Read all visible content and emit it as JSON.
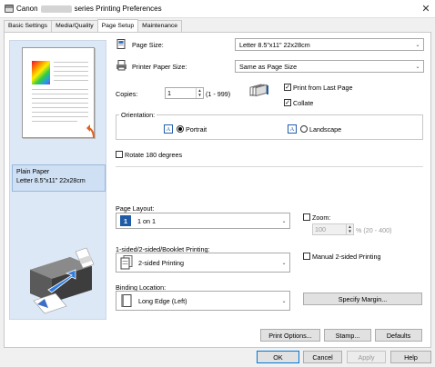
{
  "window": {
    "title_left": "Canon",
    "title_right": "series Printing Preferences",
    "close_label": "✕"
  },
  "tabs": [
    {
      "label": "Basic Settings"
    },
    {
      "label": "Media/Quality"
    },
    {
      "label": "Page Setup"
    },
    {
      "label": "Maintenance"
    }
  ],
  "preview": {
    "media_line1": "Plain Paper",
    "media_line2": "Letter 8.5\"x11\" 22x28cm"
  },
  "page_size": {
    "label": "Page Size:",
    "value": "Letter 8.5\"x11\" 22x28cm"
  },
  "printer_paper_size": {
    "label": "Printer Paper Size:",
    "value": "Same as Page Size"
  },
  "copies": {
    "label": "Copies:",
    "value": "1",
    "range": "(1 - 999)"
  },
  "print_from_last_page": {
    "label": "Print from Last Page",
    "checked": true
  },
  "collate": {
    "label": "Collate",
    "checked": true
  },
  "orientation": {
    "label": "Orientation:",
    "portrait_label": "Portrait",
    "landscape_label": "Landscape",
    "portrait_icon": "A",
    "landscape_icon": "A",
    "selected": "Portrait"
  },
  "rotate_180": {
    "label": "Rotate 180 degrees",
    "checked": false
  },
  "page_layout": {
    "label": "Page Layout:",
    "value": "1 on 1",
    "icon_text": "1"
  },
  "zoom": {
    "label": "Zoom:",
    "checked": false,
    "value": "100",
    "range": "% (20 - 400)"
  },
  "duplex": {
    "label": "1-sided/2-sided/Booklet Printing:",
    "value": "2-sided Printing"
  },
  "manual_duplex": {
    "label": "Manual 2-sided Printing",
    "checked": false
  },
  "binding": {
    "label": "Binding Location:",
    "value": "Long Edge (Left)"
  },
  "buttons": {
    "specify_margin": "Specify Margin...",
    "print_options": "Print Options...",
    "stamp": "Stamp...",
    "defaults": "Defaults",
    "ok": "OK",
    "cancel": "Cancel",
    "apply": "Apply",
    "help": "Help"
  },
  "check_mark": "✓",
  "spin_up": "▲",
  "spin_down": "▼",
  "dropdown_arrow": "⌄",
  "colors": {
    "accent_blue": "#1f5ca8",
    "preview_bg": "#dce8f5",
    "selection_bg": "#cfe0f4"
  }
}
